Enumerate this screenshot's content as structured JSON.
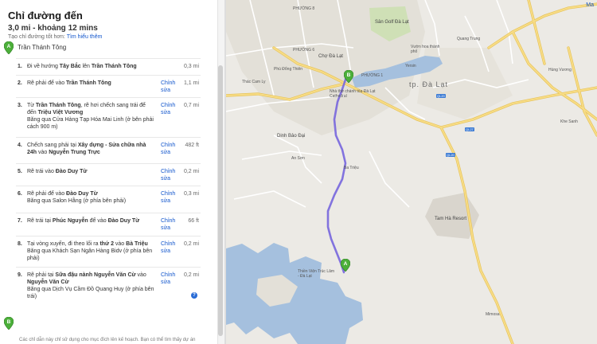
{
  "panel": {
    "title": "Chỉ đường đến",
    "summary": "3,0 mi - khoảng 12 mins",
    "hint_text": "Tạo chỉ đường tốt hơn:",
    "hint_link": "Tìm hiểu thêm",
    "start_name": "Trần Thánh Tông",
    "disclaimer": "Các chỉ dẫn này chỉ sử dụng cho mục đích lên kế hoạch. Bạn có thể tìm thấy dự án",
    "markers": {
      "start": "A",
      "end": "B"
    },
    "edit_label": "Chỉnh sửa"
  },
  "steps": [
    {
      "num": "1.",
      "pre": "Đi về hướng ",
      "b1": "Tây Bắc",
      "mid": " lên ",
      "b2": "Trần Thánh Tông",
      "post": "",
      "sub": "",
      "has_edit": false,
      "dist": "0,3 mi"
    },
    {
      "num": "2.",
      "pre": "Rẽ phải để vào ",
      "b1": "Trần Thánh Tông",
      "mid": "",
      "b2": "",
      "post": "",
      "sub": "",
      "has_edit": true,
      "dist": "1,1 mi"
    },
    {
      "num": "3.",
      "pre": "Từ ",
      "b1": "Trần Thánh Tông",
      "mid": ", rẽ hơi chếch sang trái để đến ",
      "b2": "Triệu Việt Vương",
      "post": "",
      "sub": "Băng qua Cửa Hàng Tạp Hóa Mai Linh (ở bên phải cách 900 m)",
      "has_edit": true,
      "dist": "0,7 mi"
    },
    {
      "num": "4.",
      "pre": "Chếch sang phải tại ",
      "b1": "Xây dựng - Sửa chữa nhà 24h",
      "mid": " vào ",
      "b2": "Nguyễn Trung Trực",
      "post": "",
      "sub": "",
      "has_edit": true,
      "dist": "482 ft"
    },
    {
      "num": "5.",
      "pre": "Rẽ trái vào ",
      "b1": "Đào Duy Từ",
      "mid": "",
      "b2": "",
      "post": "",
      "sub": "",
      "has_edit": true,
      "dist": "0,2 mi"
    },
    {
      "num": "6.",
      "pre": "Rẽ phải để vào ",
      "b1": "Đào Duy Từ",
      "mid": "",
      "b2": "",
      "post": "",
      "sub": "Băng qua Salon Hằng (ở phía bên phải)",
      "has_edit": true,
      "dist": "0,3 mi"
    },
    {
      "num": "7.",
      "pre": "Rẽ trái tại ",
      "b1": "Phúc Nguyễn",
      "mid": " để vào ",
      "b2": "Đào Duy Từ",
      "post": "",
      "sub": "",
      "has_edit": true,
      "dist": "66 ft"
    },
    {
      "num": "8.",
      "pre": "Tại vòng xuyến, đi theo lối ra ",
      "b1": "thứ 2",
      "mid": " vào ",
      "b2": "Bà Triệu",
      "post": "",
      "sub": "Băng qua Khách Sạn Ngân Hàng Bidv (ở phía bên phải)",
      "has_edit": true,
      "dist": "0,2 mi"
    },
    {
      "num": "9.",
      "pre": "Rẽ phải tại ",
      "b1": "Sữa đậu nành Nguyễn Văn Cừ",
      "mid": " vào ",
      "b2": "Nguyễn Văn Cừ",
      "post": "",
      "sub": "Băng qua Dịch Vụ Cầm Đồ Quang Huy (ở phía bên trái)",
      "has_edit": true,
      "dist": "0,2 mi"
    }
  ],
  "map": {
    "top_link": "Ma",
    "labels": {
      "city": "tp. Đà Lạt",
      "phuong8": "PHƯỜNG 8",
      "phuong6": "PHƯỜNG 6",
      "phuong1": "PHƯỜNG 1",
      "cho_da_lat": "Chợ Đà Lạt",
      "san_golf": "Sân Golf Đà Lạt",
      "vuon_hoa": "Vườn hoa thành phố",
      "nha_tho": "Nhà thờ chánh tòa Đà Lạt Cathedral",
      "dinh_bao_dai": "Dinh Bảo Đại",
      "tam_ha": "Tam Hà Resort",
      "thien_vien": "Thiền Viện Trúc Lâm - Đà Lạt",
      "thac_cam_ly": "Thác Cam Ly",
      "phu_dong_thien": "Phù Đổng Thiên",
      "yersin": "Yersin",
      "an_son": "An Sơn",
      "ba_trieu": "Ba Triệu",
      "quang_trung": "Quang Trung",
      "hung_vuong": "Hùng Vương",
      "mimosa": "Mimosa",
      "khe_sanh": "Khe Sanh",
      "ql20": "QL20",
      "ql27": "QL27"
    }
  },
  "colors": {
    "route": "#7766dd",
    "water": "#a5c0de",
    "road_yellow": "#f3d16d",
    "road_white": "#ffffff",
    "park": "#cfe0b6",
    "marker": "#4caf3a",
    "link": "#1155cc"
  }
}
